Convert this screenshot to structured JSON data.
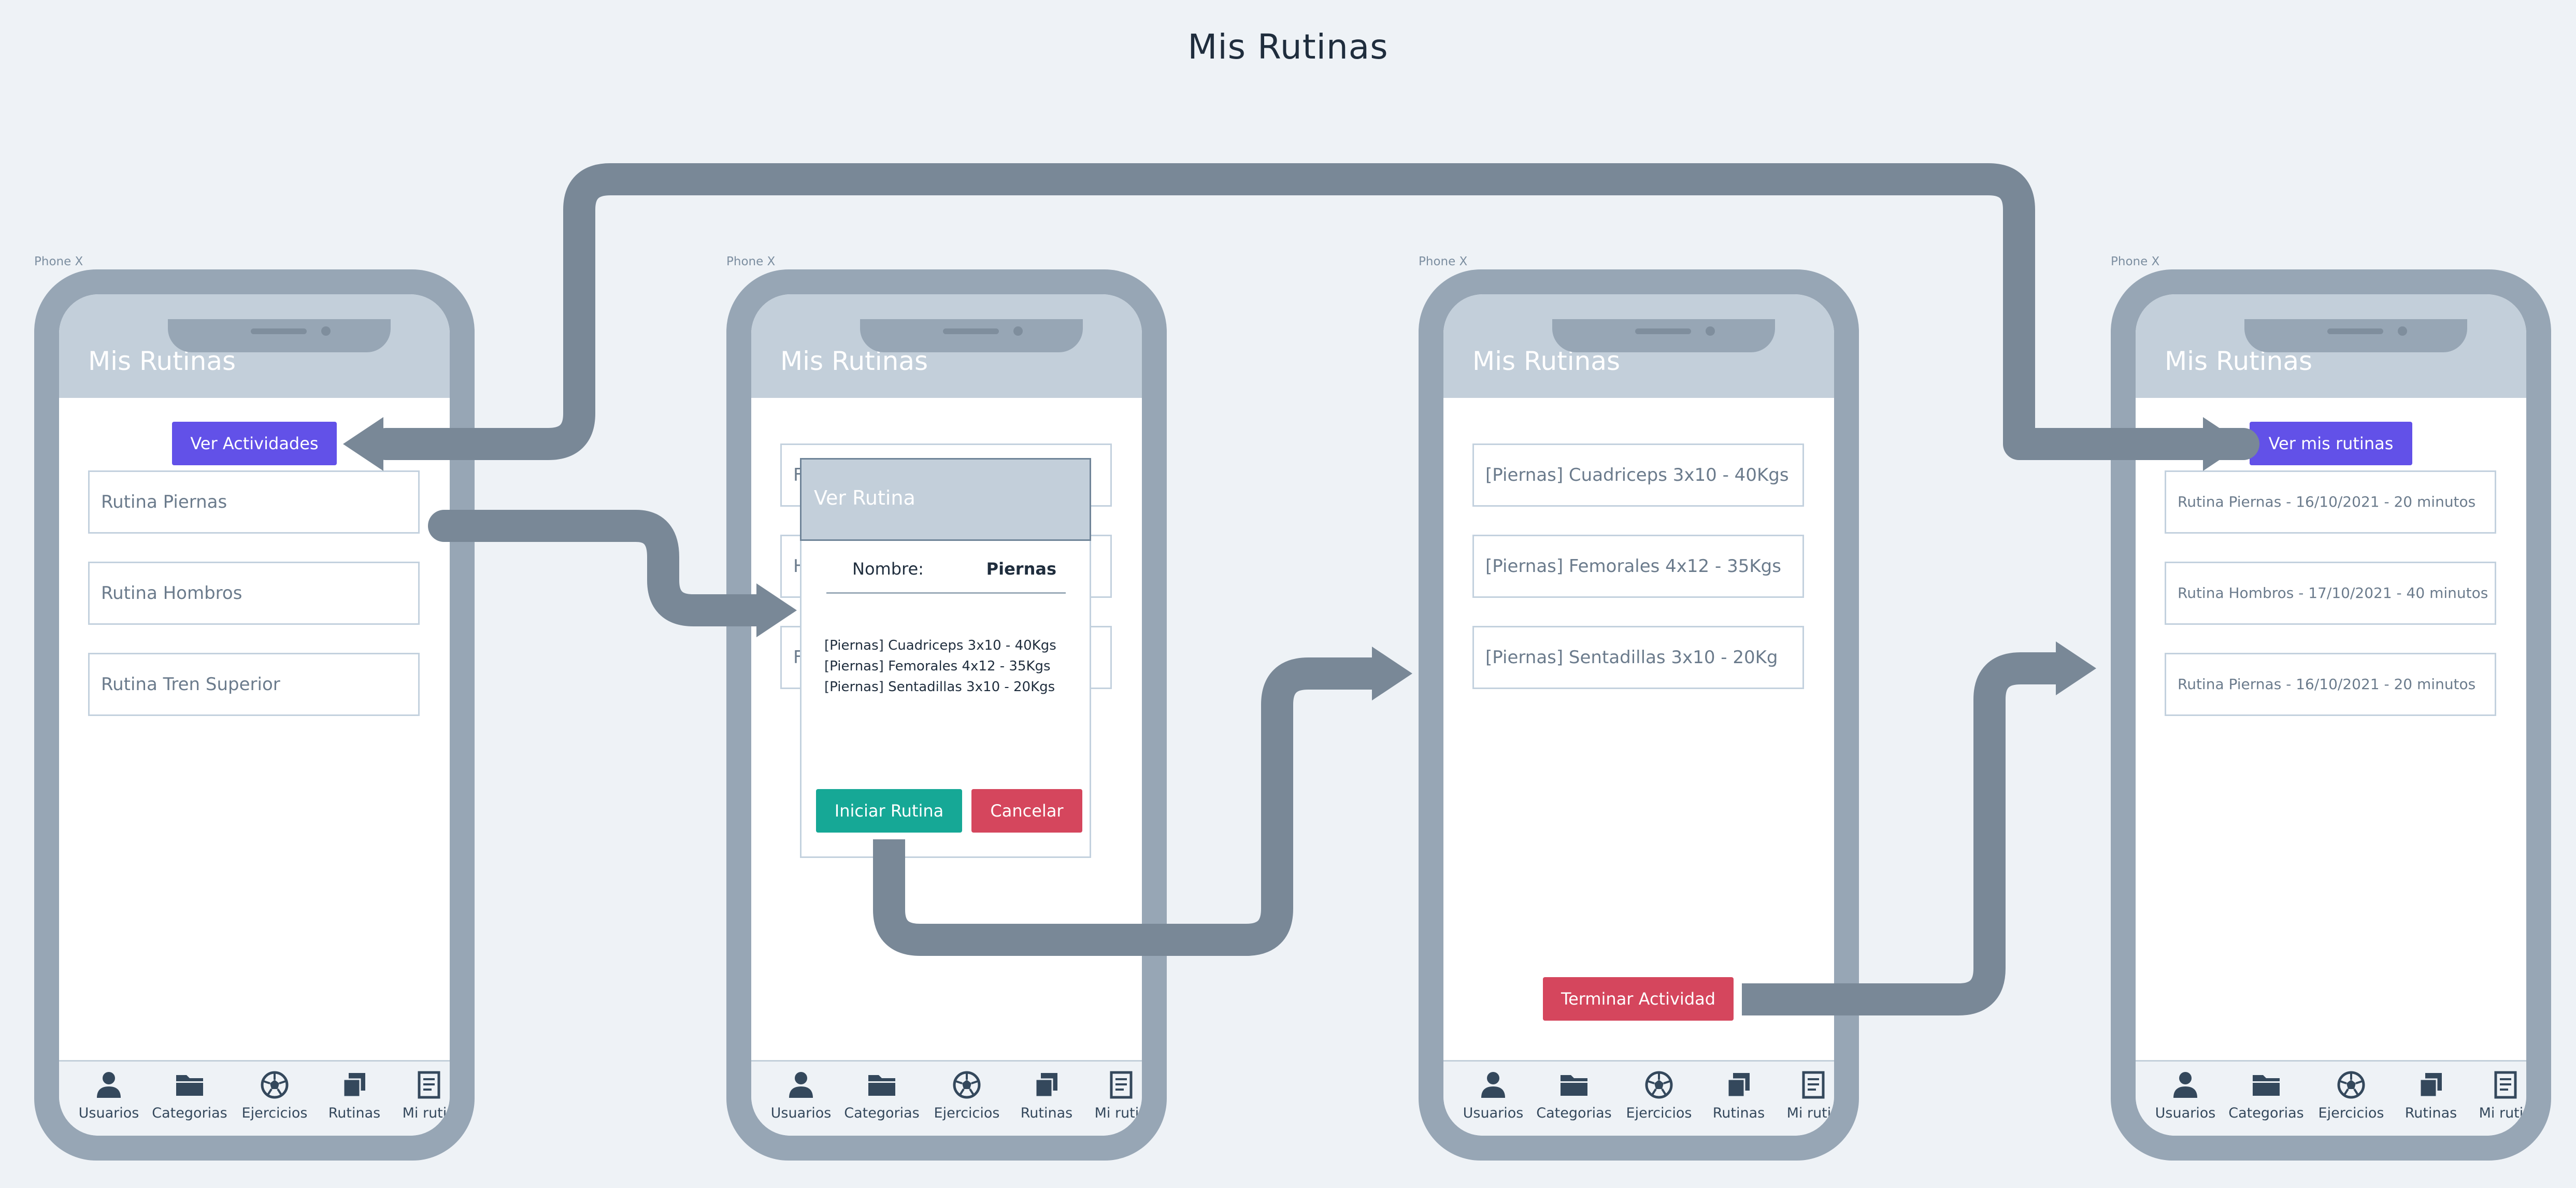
{
  "page": {
    "title": "Mis Rutinas"
  },
  "device_label": "Phone X",
  "app": {
    "header_title": "Mis Rutinas"
  },
  "tabbar": [
    {
      "label": "Usuarios",
      "icon": "user-icon"
    },
    {
      "label": "Categorias",
      "icon": "folder-icon"
    },
    {
      "label": "Ejercicios",
      "icon": "soccer-ball-icon"
    },
    {
      "label": "Rutinas",
      "icon": "copy-icon"
    },
    {
      "label": "Mi rutin",
      "icon": "document-icon"
    }
  ],
  "screen1": {
    "button": "Ver Actividades",
    "items": [
      "Rutina Piernas",
      "Rutina Hombros",
      "Rutina Tren Superior"
    ]
  },
  "screen2": {
    "behind_letters": [
      "F",
      "H",
      "F"
    ],
    "modal": {
      "title": "Ver Rutina",
      "name_label": "Nombre:",
      "name_value": "Piernas",
      "exercises": [
        "[Piernas] Cuadriceps 3x10 - 40Kgs",
        "[Piernas] Femorales 4x12 - 35Kgs",
        "[Piernas] Sentadillas 3x10 - 20Kgs"
      ],
      "start_button": "Iniciar Rutina",
      "cancel_button": "Cancelar"
    }
  },
  "screen3": {
    "items": [
      "[Piernas] Cuadriceps 3x10 - 40Kgs",
      "[Piernas] Femorales 4x12 - 35Kgs",
      "[Piernas] Sentadillas 3x10 - 20Kg"
    ],
    "finish_button": "Terminar Actividad"
  },
  "screen4": {
    "button": "Ver mis rutinas",
    "items": [
      "Rutina Piernas - 16/10/2021 - 20 minutos",
      "Rutina Hombros - 17/10/2021 - 40 minutos",
      "Rutina Piernas - 16/10/2021 - 20 minutos"
    ]
  },
  "colors": {
    "accent_purple": "#6251e8",
    "danger_red": "#d5465d",
    "success_teal": "#16a896",
    "flow_arrow": "#798897",
    "phone_frame": "#97a6b5",
    "header_bg": "#c3cfda"
  }
}
